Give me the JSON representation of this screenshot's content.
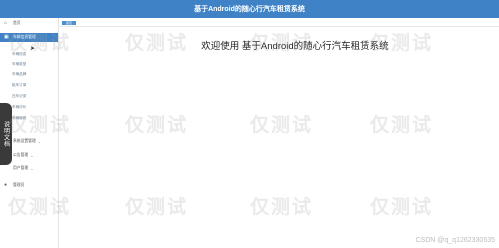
{
  "topbar": {
    "title": "基于Android的随心行汽车租赁系统"
  },
  "sidebar": {
    "home_label": "首页",
    "active_group_label": "车辆信息管理",
    "sub_items": [
      "车辆信息",
      "车辆类型",
      "车辆品牌",
      "租车订单",
      "还车记录",
      "车辆评价",
      "车辆维修"
    ],
    "more_groups": [
      {
        "label": "系统设置管理"
      },
      {
        "label": "公告管理"
      },
      {
        "label": "用户管理"
      }
    ],
    "account_label": "管理员"
  },
  "content": {
    "tab_label": "首页",
    "welcome_text": "欢迎使用 基于Android的随心行汽车租赁系统"
  },
  "float_tab": {
    "label": "说明文档"
  },
  "watermark": {
    "text": "仅测试"
  },
  "credit": {
    "text": "CSDN @q_q1262330535"
  }
}
